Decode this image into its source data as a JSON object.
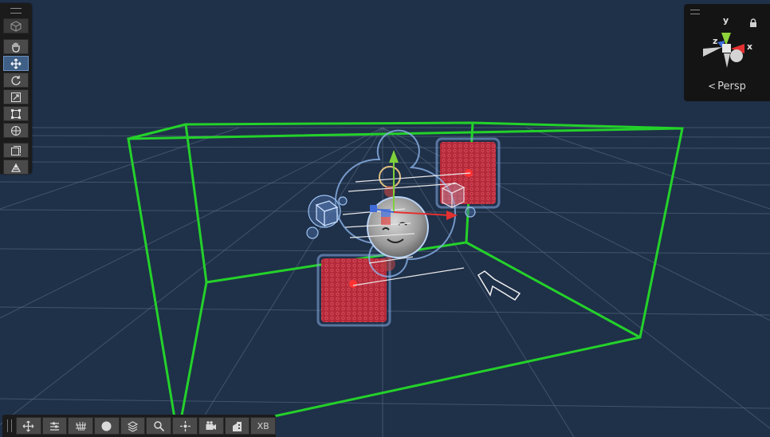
{
  "gizmo": {
    "axis_labels": {
      "x": "x",
      "y": "y",
      "z": "z"
    },
    "projection_label": "Persp",
    "lock_icon": "lock-icon"
  },
  "tool_palette": {
    "items": [
      {
        "name": "view-cube-icon",
        "active": false
      },
      {
        "name": "hand-tool-icon",
        "active": false
      },
      {
        "name": "move-tool-icon",
        "active": true
      },
      {
        "name": "rotate-tool-icon",
        "active": false
      },
      {
        "name": "scale-tool-icon",
        "active": false
      },
      {
        "name": "rect-tool-icon",
        "active": false
      },
      {
        "name": "transform-tool-icon",
        "active": false
      },
      {
        "name": "custom-editor-tool-icon",
        "active": false
      },
      {
        "name": "component-tool-icon",
        "active": false
      }
    ]
  },
  "overlay_toolbar": {
    "items": [
      {
        "name": "move-pivot-icon"
      },
      {
        "name": "draw-mode-icon"
      },
      {
        "name": "grid-icon"
      },
      {
        "name": "shading-sphere-icon"
      },
      {
        "name": "layers-icon"
      },
      {
        "name": "search-icon"
      },
      {
        "name": "scene-visibility-icon"
      },
      {
        "name": "camera-icon"
      },
      {
        "name": "building-icon"
      }
    ],
    "xb_label": "XB"
  },
  "colors": {
    "background": "#1f3049",
    "grid": "#5f7189",
    "bounds": "#24d12a",
    "gizmo_x": "#e43030",
    "gizmo_y": "#7ed03a",
    "gizmo_z": "#3e6bd8",
    "particles": "#c43040"
  }
}
